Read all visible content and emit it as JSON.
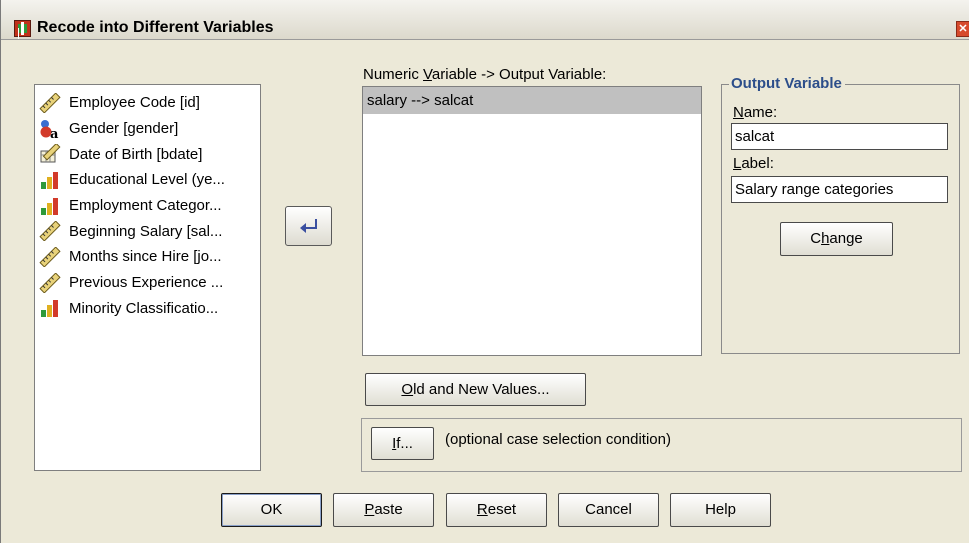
{
  "window": {
    "title": "Recode into Different Variables",
    "close_glyph": "✕"
  },
  "variables": [
    {
      "label": "Employee Code [id]",
      "icon": "ruler-scale-icon"
    },
    {
      "label": "Gender [gender]",
      "icon": "nominal-string-icon"
    },
    {
      "label": "Date of Birth [bdate]",
      "icon": "date-scale-icon"
    },
    {
      "label": "Educational Level (ye...",
      "icon": "ordinal-bar-icon"
    },
    {
      "label": "Employment Categor...",
      "icon": "ordinal-bar-icon"
    },
    {
      "label": "Beginning Salary [sal...",
      "icon": "ruler-scale-icon"
    },
    {
      "label": "Months since Hire [jo...",
      "icon": "ruler-scale-icon"
    },
    {
      "label": "Previous Experience ...",
      "icon": "ruler-scale-icon"
    },
    {
      "label": "Minority Classificatio...",
      "icon": "ordinal-bar-icon"
    }
  ],
  "mapping": {
    "header_pre": "Numeric ",
    "header_u": "V",
    "header_post": "ariable -> Output Variable:",
    "rows": [
      "salary --> salcat"
    ]
  },
  "output": {
    "legend": "Output Variable",
    "name_u": "N",
    "name_rest": "ame:",
    "name_value": "salcat",
    "label_u": "L",
    "label_rest": "abel:",
    "label_value": "Salary range categories",
    "change_pre": "C",
    "change_u": "h",
    "change_post": "ange"
  },
  "buttons": {
    "old_new_u": "O",
    "old_new_rest": "ld and New Values...",
    "if_u": "I",
    "if_rest": "f...",
    "if_hint": "(optional case selection condition)",
    "ok": "OK",
    "paste_u": "P",
    "paste_rest": "aste",
    "reset_u": "R",
    "reset_rest": "eset",
    "cancel": "Cancel",
    "help": "Help"
  },
  "colors": {
    "legend": "#2c4e8a",
    "selected_row": "#c0c0c0",
    "arrow": "#3a4fa0"
  }
}
